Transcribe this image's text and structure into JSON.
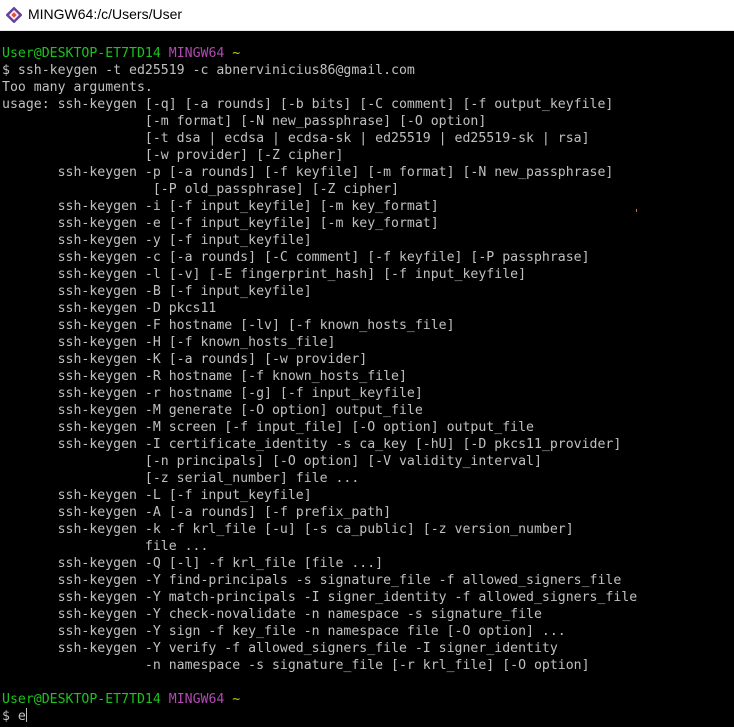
{
  "window": {
    "title": "MINGW64:/c/Users/User"
  },
  "colors": {
    "background": "#000000",
    "text": "#c0c0c0",
    "user_host": "#1cc41c",
    "env": "#b14ab1",
    "path": "#c8c800"
  },
  "terminal": {
    "prompt1": {
      "user_host": "User@DESKTOP-ET7TD14",
      "env": "MINGW64",
      "path": "~"
    },
    "command1": "$ ssh-keygen -t ed25519 -c abnervinicius86@gmail.com",
    "output": [
      "Too many arguments.",
      "usage: ssh-keygen [-q] [-a rounds] [-b bits] [-C comment] [-f output_keyfile]",
      "                  [-m format] [-N new_passphrase] [-O option]",
      "                  [-t dsa | ecdsa | ecdsa-sk | ed25519 | ed25519-sk | rsa]",
      "                  [-w provider] [-Z cipher]",
      "       ssh-keygen -p [-a rounds] [-f keyfile] [-m format] [-N new_passphrase]",
      "                   [-P old_passphrase] [-Z cipher]",
      "       ssh-keygen -i [-f input_keyfile] [-m key_format]",
      "       ssh-keygen -e [-f input_keyfile] [-m key_format]",
      "       ssh-keygen -y [-f input_keyfile]",
      "       ssh-keygen -c [-a rounds] [-C comment] [-f keyfile] [-P passphrase]",
      "       ssh-keygen -l [-v] [-E fingerprint_hash] [-f input_keyfile]",
      "       ssh-keygen -B [-f input_keyfile]",
      "       ssh-keygen -D pkcs11",
      "       ssh-keygen -F hostname [-lv] [-f known_hosts_file]",
      "       ssh-keygen -H [-f known_hosts_file]",
      "       ssh-keygen -K [-a rounds] [-w provider]",
      "       ssh-keygen -R hostname [-f known_hosts_file]",
      "       ssh-keygen -r hostname [-g] [-f input_keyfile]",
      "       ssh-keygen -M generate [-O option] output_file",
      "       ssh-keygen -M screen [-f input_file] [-O option] output_file",
      "       ssh-keygen -I certificate_identity -s ca_key [-hU] [-D pkcs11_provider]",
      "                  [-n principals] [-O option] [-V validity_interval]",
      "                  [-z serial_number] file ...",
      "       ssh-keygen -L [-f input_keyfile]",
      "       ssh-keygen -A [-a rounds] [-f prefix_path]",
      "       ssh-keygen -k -f krl_file [-u] [-s ca_public] [-z version_number]",
      "                  file ...",
      "       ssh-keygen -Q [-l] -f krl_file [file ...]",
      "       ssh-keygen -Y find-principals -s signature_file -f allowed_signers_file",
      "       ssh-keygen -Y match-principals -I signer_identity -f allowed_signers_file",
      "       ssh-keygen -Y check-novalidate -n namespace -s signature_file",
      "       ssh-keygen -Y sign -f key_file -n namespace file [-O option] ...",
      "       ssh-keygen -Y verify -f allowed_signers_file -I signer_identity",
      "                  -n namespace -s signature_file [-r krl_file] [-O option]"
    ],
    "prompt2": {
      "user_host": "User@DESKTOP-ET7TD14",
      "env": "MINGW64",
      "path": "~"
    },
    "current_input": "$ e"
  }
}
